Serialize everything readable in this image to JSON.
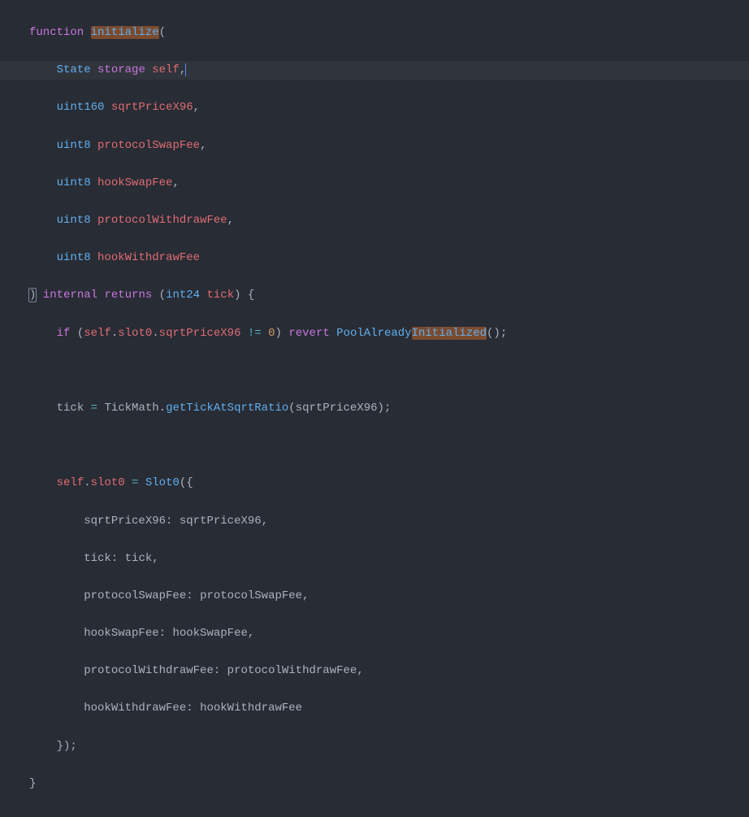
{
  "code": {
    "kw_function": "function",
    "fn_name": "initialize",
    "paren_open": "(",
    "param1_type": "State",
    "param1_storage": "storage",
    "param1_name": "self",
    "comma": ",",
    "param2_type": "uint160",
    "param2_name": "sqrtPriceX96",
    "param3_type": "uint8",
    "param3_name": "protocolSwapFee",
    "param4_type": "uint8",
    "param4_name": "hookSwapFee",
    "param5_type": "uint8",
    "param5_name": "protocolWithdrawFee",
    "param6_type": "uint8",
    "param6_name": "hookWithdrawFee",
    "paren_close": ")",
    "kw_internal": "internal",
    "kw_returns": "returns",
    "ret_type": "int24",
    "ret_name": "tick",
    "brace_open": "{",
    "kw_if": "if",
    "self": "self",
    "dot": ".",
    "slot0": "slot0",
    "sqrtPriceX96_field": "sqrtPriceX96",
    "neq": "!=",
    "zero": "0",
    "kw_revert": "revert",
    "err_prefix": "PoolAlready",
    "err_suffix": "Initialized",
    "parens_empty": "()",
    "semi": ";",
    "tick_var": "tick",
    "eq": "=",
    "TickMath": "TickMath",
    "getTickAtSqrtRatio": "getTickAtSqrtRatio",
    "Slot0_ctor": "Slot0",
    "brace_open2": "({",
    "f_sqrtPriceX96": "sqrtPriceX96",
    "colon": ":",
    "f_tick": "tick",
    "f_protocolSwapFee": "protocolSwapFee",
    "f_hookSwapFee": "hookSwapFee",
    "f_protocolWithdrawFee": "protocolWithdrawFee",
    "f_hookWithdrawFee": "hookWithdrawFee",
    "brace_close2": "})",
    "brace_close": "}",
    "space": " "
  }
}
